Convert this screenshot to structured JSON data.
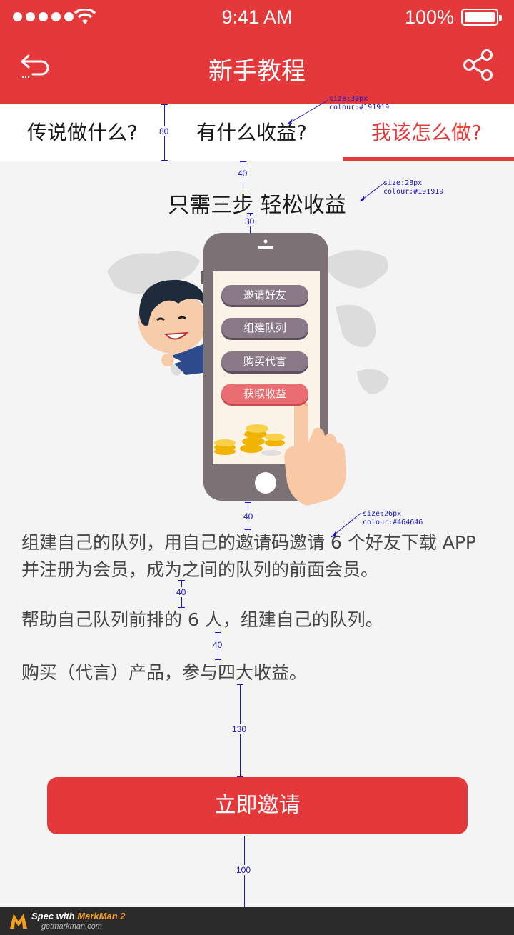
{
  "status_bar": {
    "time": "9:41 AM",
    "battery": "100%"
  },
  "navbar": {
    "title": "新手教程"
  },
  "tabs": [
    {
      "label": "传说做什么?"
    },
    {
      "label": "有什么收益?"
    },
    {
      "label": "我该怎么做?"
    }
  ],
  "heading": "只需三步 轻松收益",
  "illustration": {
    "buttons": [
      "邀请好友",
      "组建队列",
      "购买代言",
      "获取收益"
    ]
  },
  "description": {
    "para1_line1": "组建自己的队列，用自己的邀请码邀请 6 个好友下载 APP",
    "para1_line2": "并注册为会员，成为之间的队列的前面会员。",
    "para2": "帮助自己队列前排的 6 人，组建自己的队列。",
    "para3": "购买（代言）产品，参与四大收益。"
  },
  "invite_button": "立即邀请",
  "annotations": {
    "tab_spec_size": "size:30px",
    "tab_spec_colour": "colour:#191919",
    "heading_spec_size": "size:28px",
    "heading_spec_colour": "colour:#191919",
    "desc_spec_size": "size:26px",
    "desc_spec_colour": "colour:#464646",
    "dim_tab_height": "80",
    "dim_tab_to_heading": "40",
    "dim_heading_to_phone": "30",
    "dim_phone_to_desc": "40",
    "dim_para1_para2": "40",
    "dim_para2_para3": "40",
    "dim_para3_button": "130",
    "dim_button_bottom": "100"
  },
  "footer": {
    "spec_prefix": "Spec with ",
    "spec_brand": "MarkMan 2",
    "site": "getmarkman.com"
  },
  "colors": {
    "brand_red": "#e5383b",
    "text_dark": "#191919",
    "text_body": "#464646",
    "background": "#f4f4f4"
  }
}
